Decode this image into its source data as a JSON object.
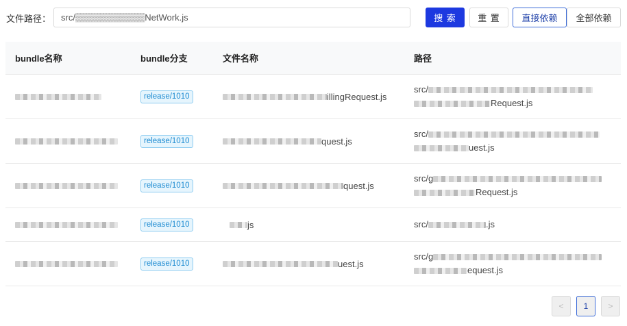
{
  "search": {
    "label": "文件路径：",
    "value": "src/▒▒▒▒▒▒▒▒▒▒▒NetWork.js"
  },
  "buttons": {
    "search": "搜 索",
    "reset": "重 置",
    "direct": "直接依赖",
    "all": "全部依赖"
  },
  "table": {
    "headers": [
      "bundle名称",
      "bundle分支",
      "文件名称",
      "路径"
    ],
    "rows": [
      {
        "branch": "release/1010",
        "file_suffix": "illingRequest.js",
        "path1": "src/",
        "path2_suffix": "Request.js"
      },
      {
        "branch": "release/1010",
        "file_suffix": "quest.js",
        "path1": "src/",
        "path2_suffix": "uest.js"
      },
      {
        "branch": "release/1010",
        "file_suffix": "quest.js",
        "path1": "src/g",
        "path2_suffix": "Request.js"
      },
      {
        "branch": "release/1010",
        "file_suffix": "js",
        "path1": "src/",
        "path2_suffix": ".js"
      },
      {
        "branch": "release/1010",
        "file_suffix": "uest.js",
        "path1": "src/g",
        "path2_suffix": "equest.js"
      }
    ]
  },
  "pagination": {
    "prev": "<",
    "current": "1",
    "next": ">"
  }
}
